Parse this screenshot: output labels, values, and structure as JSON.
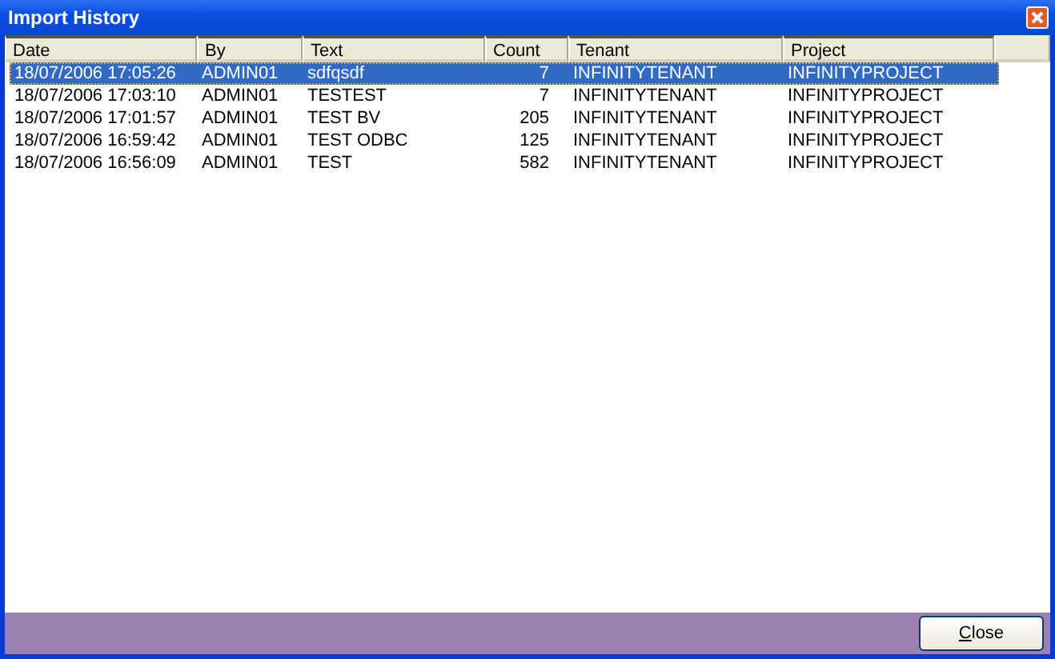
{
  "window": {
    "title": "Import History"
  },
  "table": {
    "columns": [
      "Date",
      "By",
      "Text",
      "Count",
      "Tenant",
      "Project"
    ],
    "rows": [
      {
        "cells": [
          "18/07/2006 17:05:26",
          "ADMIN01",
          "sdfqsdf",
          "7",
          "INFINITYTENANT",
          "INFINITYPROJECT"
        ],
        "selected": true
      },
      {
        "cells": [
          "18/07/2006 17:03:10",
          "ADMIN01",
          "TESTEST",
          "7",
          "INFINITYTENANT",
          "INFINITYPROJECT"
        ],
        "selected": false
      },
      {
        "cells": [
          "18/07/2006 17:01:57",
          "ADMIN01",
          "TEST BV",
          "205",
          "INFINITYTENANT",
          "INFINITYPROJECT"
        ],
        "selected": false
      },
      {
        "cells": [
          "18/07/2006 16:59:42",
          "ADMIN01",
          "TEST ODBC",
          "125",
          "INFINITYTENANT",
          "INFINITYPROJECT"
        ],
        "selected": false
      },
      {
        "cells": [
          "18/07/2006 16:56:09",
          "ADMIN01",
          "TEST",
          "582",
          "INFINITYTENANT",
          "INFINITYPROJECT"
        ],
        "selected": false
      }
    ]
  },
  "buttons": [
    {
      "label": "Close"
    }
  ]
}
